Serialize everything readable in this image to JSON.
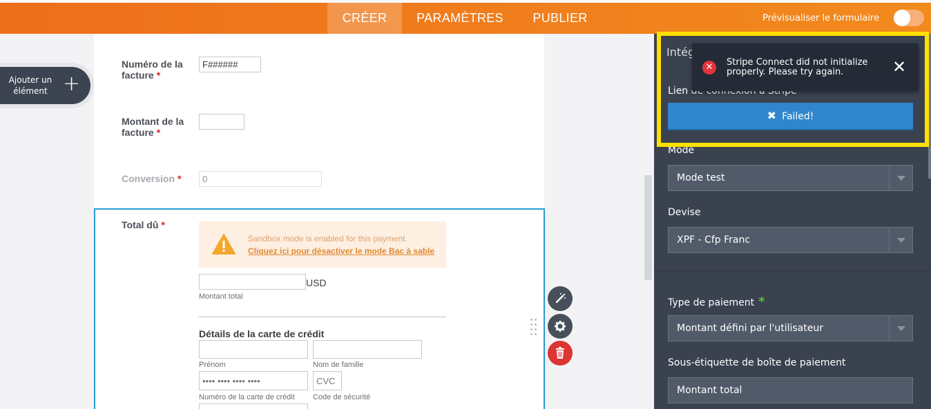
{
  "topbar": {
    "tabs": [
      {
        "label": "CRÉER"
      },
      {
        "label": "PARAMÈTRES"
      },
      {
        "label": "PUBLIER"
      }
    ],
    "preview_label": "Prévisualiser le formulaire"
  },
  "add_element": {
    "label": "Ajouter un élément",
    "icon": "plus-icon"
  },
  "form": {
    "invoice_number": {
      "label": "Numéro de la facture",
      "required": "*",
      "value": "F######"
    },
    "invoice_amount": {
      "label": "Montant de la facture",
      "required": "*",
      "value": ""
    },
    "conversion": {
      "label": "Conversion",
      "required": "*",
      "value": "0"
    },
    "total_due": {
      "label": "Total dû",
      "required": "*",
      "notice_text": "Sandbox mode is enabled for this payment.",
      "notice_link": "Cliquez ici pour désactiver le mode Bac à sable",
      "amount_value": "",
      "currency": "USD",
      "amount_sublabel": "Montant total",
      "cc_title": "Détails de la carte de crédit",
      "first_name_label": "Prénom",
      "last_name_label": "Nom de famille",
      "card_placeholder": "•••• •••• •••• ••••",
      "card_label": "Numéro de la carte de crédit",
      "cvc_placeholder": "CVC",
      "cvc_label": "Code de sécurité"
    }
  },
  "tools": {
    "wand": "magic-wand-icon",
    "settings": "gear-icon",
    "delete": "trash-icon"
  },
  "right_panel": {
    "header": "Intég",
    "stripe_link_label": "Lien de connexion à Stripe",
    "failed_button": "Failed!",
    "mode_label": "Mode",
    "mode_value": "Mode test",
    "currency_label": "Devise",
    "currency_value": "XPF - Cfp Franc",
    "payment_type_label": "Type de paiement",
    "payment_type_value": "Montant défini par l'utilisateur",
    "subtitle_label": "Sous-étiquette de boîte de paiement",
    "subtitle_value": "Montant total"
  },
  "toast": {
    "message": "Stripe Connect did not initialize properly. Please try again.",
    "icon": "error-icon",
    "close_icon": "close-icon"
  },
  "colors": {
    "accent": "#f08020",
    "panel": "#3a4250",
    "highlight": "#ffe100",
    "button_blue": "#2f86cc",
    "error": "#e5343c"
  }
}
